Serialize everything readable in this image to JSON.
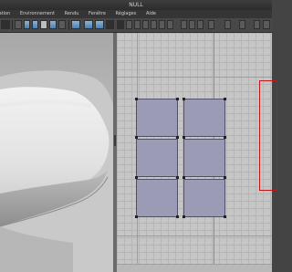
{
  "window": {
    "title": "NULL"
  },
  "menu": {
    "items": [
      "sation",
      "Environnement",
      "Rendu",
      "Fenêtre",
      "Réglages",
      "Aide"
    ]
  },
  "colors": {
    "uv_fill": "#9b9bb5",
    "selection_border": "#c01818",
    "viewport_bg": "#c6c6c6"
  },
  "toolbar": {
    "icons": [
      "select-icon",
      "move-icon",
      "rotate-icon",
      "scale-icon",
      "uv-icon",
      "camera-icon",
      "mesh-icon",
      "paint-icon",
      "sphere-icon",
      "cube-icon"
    ]
  },
  "uv_editor": {
    "tiles": 6
  }
}
